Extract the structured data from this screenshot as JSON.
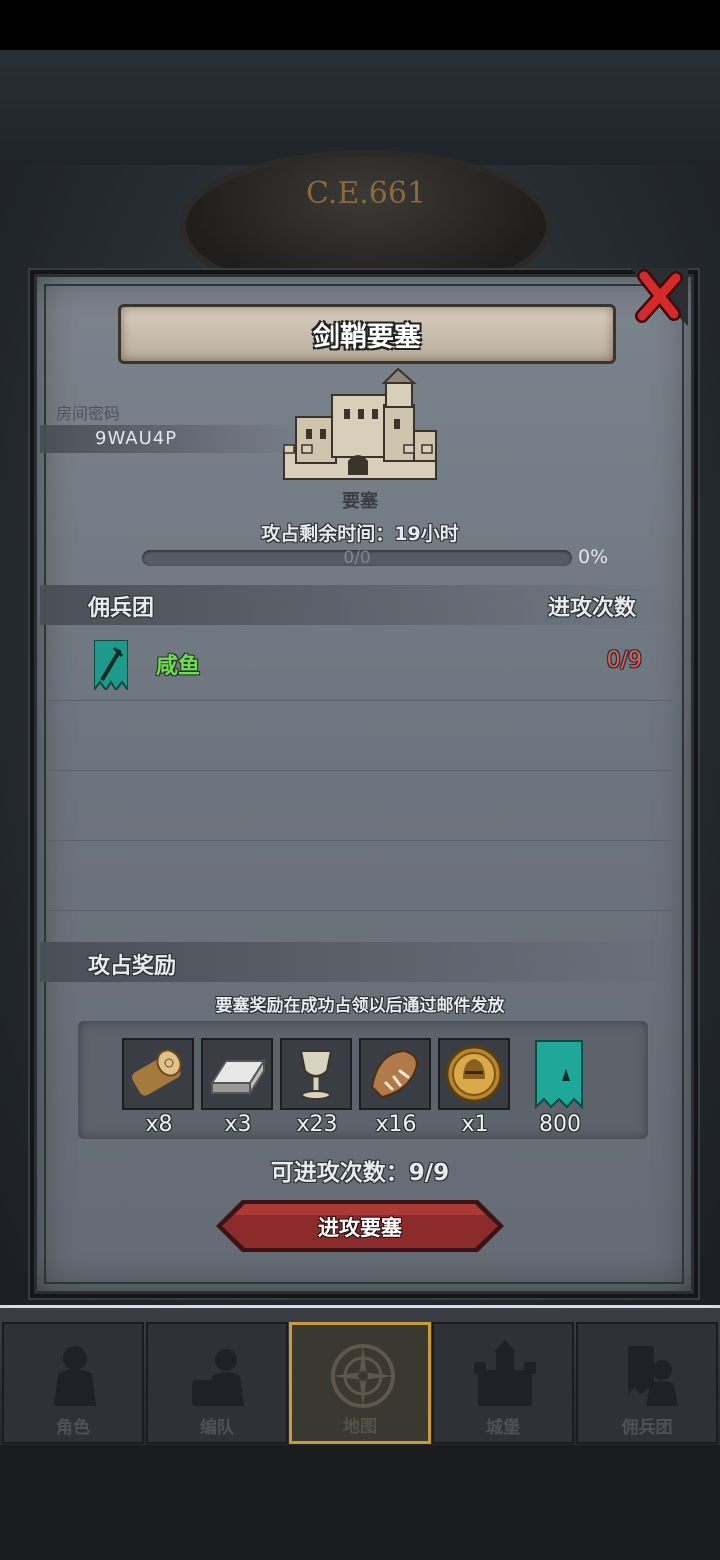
{
  "background": {
    "year_label": "C.E.661"
  },
  "dialog": {
    "title": "剑鞘要塞",
    "room": {
      "label": "房间密码",
      "code": "9WAU4P"
    },
    "fortress": {
      "type_label": "要塞",
      "timer_label": "攻占剩余时间：",
      "timer_value": "19",
      "timer_unit": "小时",
      "progress_count": "0/0",
      "progress_percent": "0%",
      "progress_fraction": 0
    },
    "mercenary_section": {
      "title": "佣兵团",
      "attacks_header": "进攻次数",
      "rows": [
        {
          "name": "咸鱼",
          "attacks": "0/9"
        }
      ]
    },
    "reward_section": {
      "title": "攻占奖励",
      "note": "要塞奖励在成功占领以后通过邮件发放",
      "items": [
        {
          "icon": "wood-log-icon",
          "qty": "x8"
        },
        {
          "icon": "iron-ingot-icon",
          "qty": "x3"
        },
        {
          "icon": "goblet-icon",
          "qty": "x23"
        },
        {
          "icon": "fur-pelt-icon",
          "qty": "x16"
        },
        {
          "icon": "helmet-coin-icon",
          "qty": "x1"
        },
        {
          "icon": "guild-banner-icon",
          "qty": "800"
        }
      ]
    },
    "attacks_remaining_label": "可进攻次数：",
    "attacks_remaining_value": "9/9",
    "attack_button": "进攻要塞"
  },
  "nav": {
    "items": [
      {
        "label": "角色",
        "icon": "character-icon",
        "active": false
      },
      {
        "label": "编队",
        "icon": "formation-icon",
        "active": false
      },
      {
        "label": "地图",
        "icon": "compass-map-icon",
        "active": true
      },
      {
        "label": "城堡",
        "icon": "castle-icon",
        "active": false
      },
      {
        "label": "佣兵团",
        "icon": "mercenary-icon",
        "active": false
      }
    ]
  },
  "colors": {
    "dialog_bg": "#6c747d",
    "merc_name": "#6ddf4c",
    "merc_attacks": "#ea5a5a",
    "attack_button": "#8c2b2b",
    "nav_active_border": "#c89a3a"
  }
}
